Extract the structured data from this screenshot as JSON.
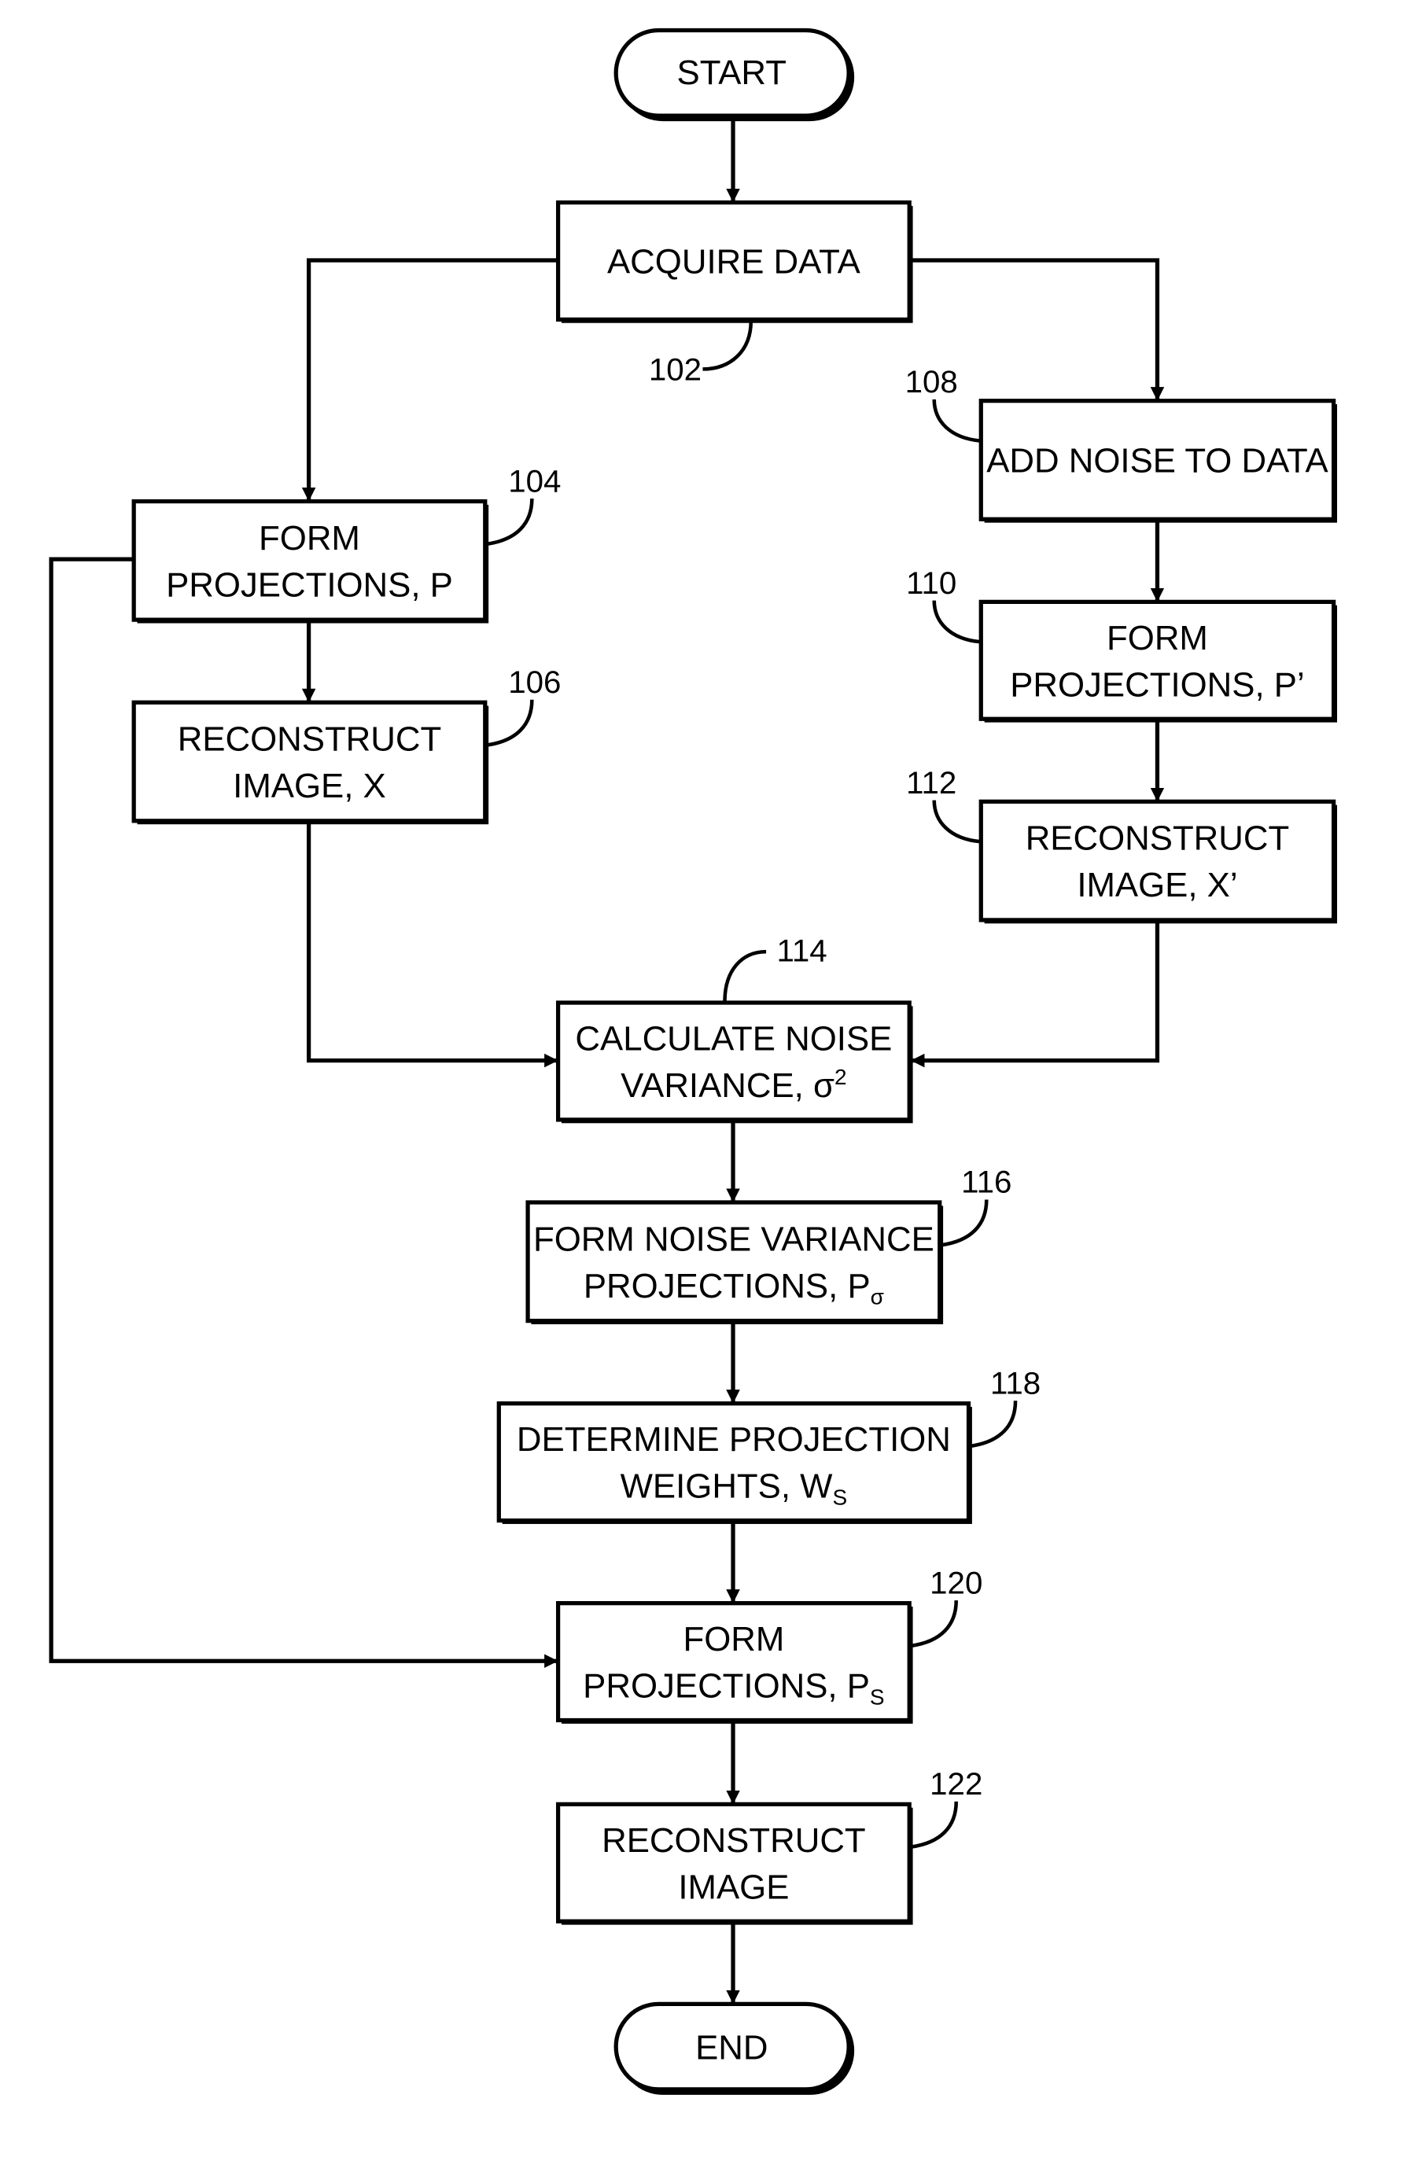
{
  "figure": {
    "type": "flowchart",
    "terminals": {
      "start": "START",
      "end": "END"
    },
    "steps": [
      {
        "id": "102",
        "ref": "102",
        "lines": [
          "ACQUIRE DATA"
        ]
      },
      {
        "id": "104",
        "ref": "104",
        "lines": [
          "FORM",
          "PROJECTIONS, P"
        ]
      },
      {
        "id": "106",
        "ref": "106",
        "lines": [
          "RECONSTRUCT",
          "IMAGE, X"
        ]
      },
      {
        "id": "108",
        "ref": "108",
        "lines": [
          "ADD NOISE TO DATA"
        ]
      },
      {
        "id": "110",
        "ref": "110",
        "lines": [
          "FORM",
          "PROJECTIONS, P’"
        ]
      },
      {
        "id": "112",
        "ref": "112",
        "lines": [
          "RECONSTRUCT",
          "IMAGE, X’"
        ]
      },
      {
        "id": "114",
        "ref": "114",
        "lines": [
          "CALCULATE NOISE",
          "VARIANCE, σ"
        ],
        "sup": "2"
      },
      {
        "id": "116",
        "ref": "116",
        "lines": [
          "FORM NOISE VARIANCE",
          "PROJECTIONS, P"
        ],
        "sub": "σ"
      },
      {
        "id": "118",
        "ref": "118",
        "lines": [
          "DETERMINE PROJECTION",
          "WEIGHTS, W"
        ],
        "sub": "S"
      },
      {
        "id": "120",
        "ref": "120",
        "lines": [
          "FORM",
          "PROJECTIONS, P"
        ],
        "sub": "S"
      },
      {
        "id": "122",
        "ref": "122",
        "lines": [
          "RECONSTRUCT",
          "IMAGE"
        ]
      }
    ],
    "edges": [
      [
        "start",
        "102"
      ],
      [
        "102",
        "104"
      ],
      [
        "102",
        "108"
      ],
      [
        "104",
        "106"
      ],
      [
        "108",
        "110"
      ],
      [
        "110",
        "112"
      ],
      [
        "106",
        "114"
      ],
      [
        "112",
        "114"
      ],
      [
        "114",
        "116"
      ],
      [
        "116",
        "118"
      ],
      [
        "118",
        "120"
      ],
      [
        "104",
        "120"
      ],
      [
        "120",
        "122"
      ],
      [
        "122",
        "end"
      ]
    ]
  }
}
